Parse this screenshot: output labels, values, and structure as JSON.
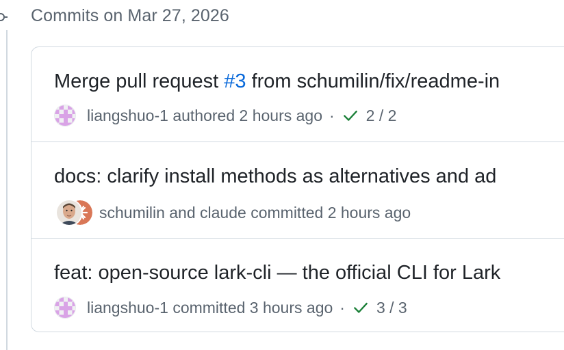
{
  "group": {
    "title": "Commits on Mar 27, 2026"
  },
  "commits": [
    {
      "title_before": "Merge pull request ",
      "pr_number": "#3",
      "title_after": " from schumilin/fix/readme-in",
      "author": "liangshuo-1",
      "action": "authored",
      "time": "2 hours ago",
      "separator": "·",
      "checks": "2 / 2"
    },
    {
      "title": "docs: clarify install methods as alternatives and ad",
      "author": "schumilin",
      "conjunction": "and",
      "coauthor": "claude",
      "action": "committed",
      "time": "2 hours ago"
    },
    {
      "title": "feat: open-source lark-cli — the official CLI for Lark",
      "author": "liangshuo-1",
      "action": "committed",
      "time": "3 hours ago",
      "separator": "·",
      "checks": "3 / 3"
    }
  ],
  "colors": {
    "status_success": "#1a7f37",
    "link": "#0969da",
    "muted_text": "#59636e",
    "border": "#d1d9e0"
  },
  "icons": {
    "timeline": "git-commit-icon",
    "check": "check-icon",
    "avatar_identicon": "identicon-avatar",
    "avatar_person": "person-avatar",
    "avatar_claude": "claude-logo-avatar"
  }
}
